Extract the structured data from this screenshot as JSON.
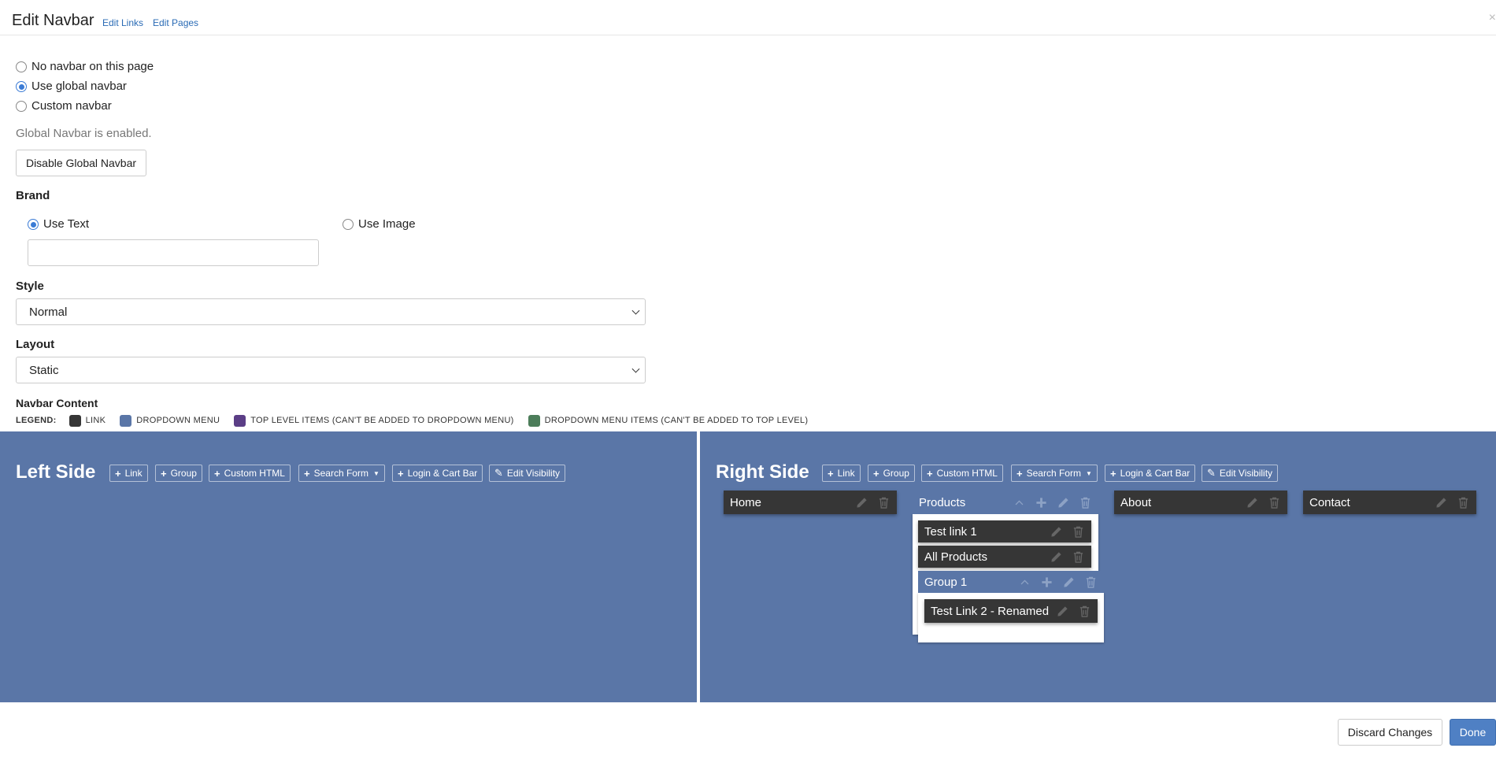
{
  "header": {
    "title": "Edit Navbar",
    "links": [
      "Edit Links",
      "Edit Pages"
    ],
    "close": "×"
  },
  "navbar_mode": {
    "options": [
      "No navbar on this page",
      "Use global navbar",
      "Custom navbar"
    ],
    "selected": "Use global navbar"
  },
  "global_status": "Global Navbar is enabled.",
  "disable_button": "Disable Global Navbar",
  "brand": {
    "heading": "Brand",
    "options": [
      "Use Text",
      "Use Image"
    ],
    "selected": "Use Text",
    "text_value": ""
  },
  "style": {
    "heading": "Style",
    "value": "Normal"
  },
  "layout": {
    "heading": "Layout",
    "value": "Static"
  },
  "navbar_content": {
    "heading": "Navbar Content",
    "legend_title": "LEGEND:",
    "legend": [
      {
        "label": "LINK",
        "color": "#363636"
      },
      {
        "label": "DROPDOWN MENU",
        "color": "#5a76a7"
      },
      {
        "label": "TOP LEVEL ITEMS (CAN'T BE ADDED TO DROPDOWN MENU)",
        "color": "#5b3e86"
      },
      {
        "label": "DROPDOWN MENU ITEMS (CAN'T BE ADDED TO TOP LEVEL)",
        "color": "#4c7d5a"
      }
    ]
  },
  "toolbar": {
    "link": "Link",
    "group": "Group",
    "custom_html": "Custom HTML",
    "search_form": "Search Form",
    "login_cart": "Login & Cart Bar",
    "edit_visibility": "Edit Visibility"
  },
  "left_side": {
    "title": "Left Side"
  },
  "right_side": {
    "title": "Right Side",
    "items": {
      "home": "Home",
      "products": "Products",
      "about": "About",
      "contact": "Contact",
      "test_link_1": "Test link 1",
      "all_products": "All Products",
      "group_1": "Group 1",
      "test_link_2": "Test Link 2 - Renamed"
    }
  },
  "footer": {
    "discard": "Discard Changes",
    "done": "Done"
  },
  "colors": {
    "panel": "#5a76a7",
    "link_item": "#363636",
    "accent": "#3a7bd5",
    "done_button": "#4f80c4"
  }
}
